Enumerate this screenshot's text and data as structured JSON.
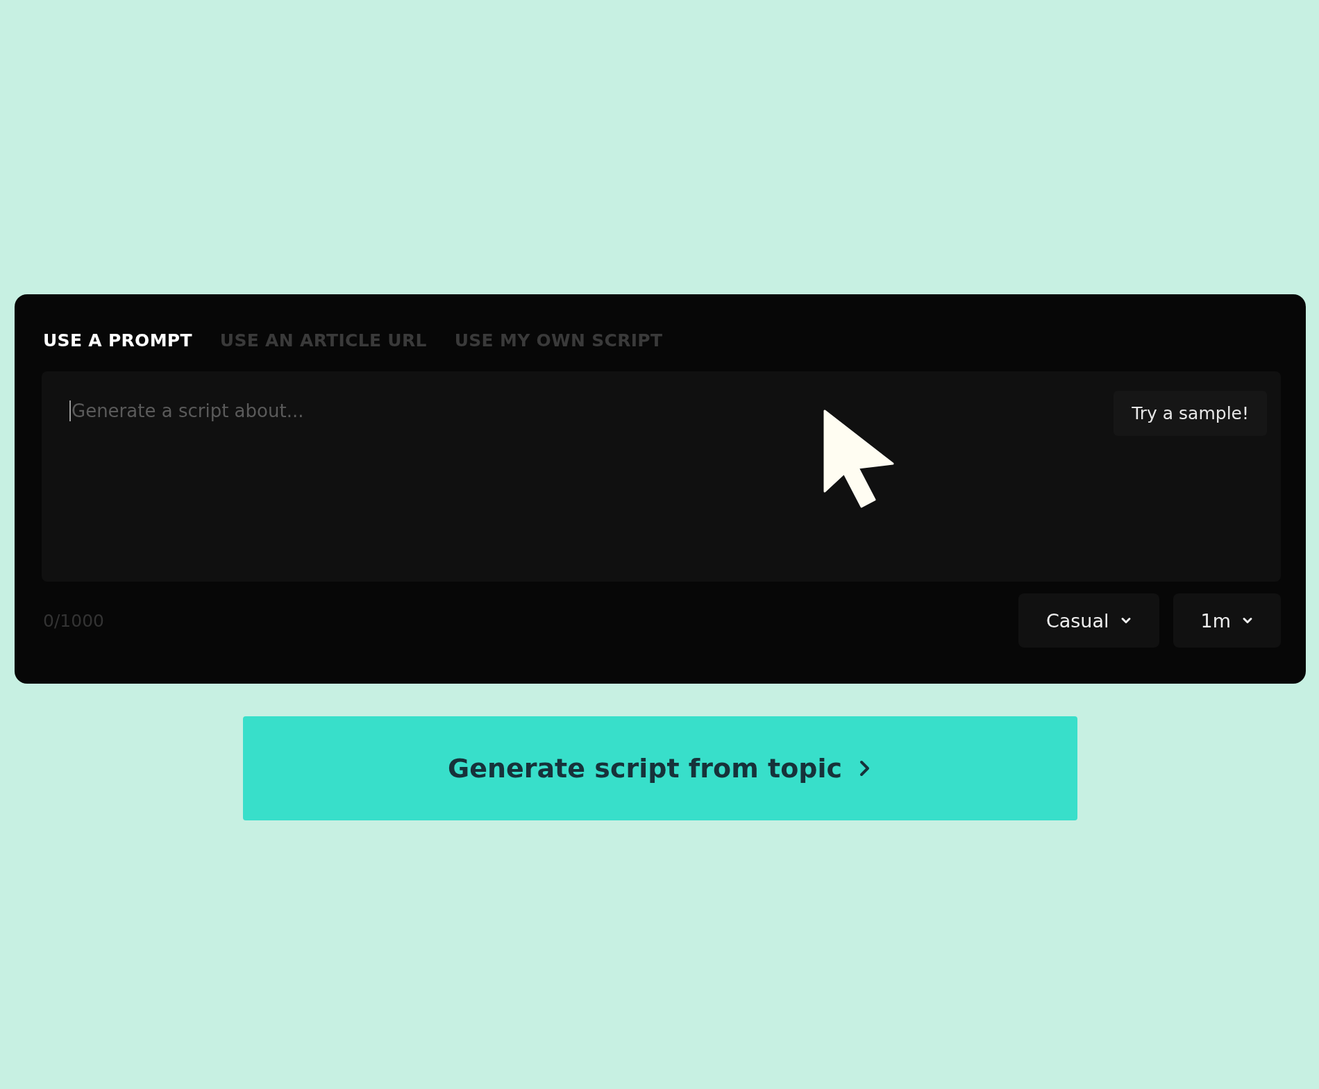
{
  "tabs": [
    {
      "label": "USE A PROMPT",
      "selected": true
    },
    {
      "label": "USE AN ARTICLE URL",
      "selected": false
    },
    {
      "label": "USE MY OWN SCRIPT",
      "selected": false
    }
  ],
  "prompt": {
    "placeholder": "Generate a script about...",
    "focused": true
  },
  "sample_button": "Try a sample!",
  "char_count": "0/1000",
  "dropdowns": [
    {
      "value": "Casual"
    },
    {
      "value": "1m"
    }
  ],
  "generate_button": "Generate script from topic"
}
